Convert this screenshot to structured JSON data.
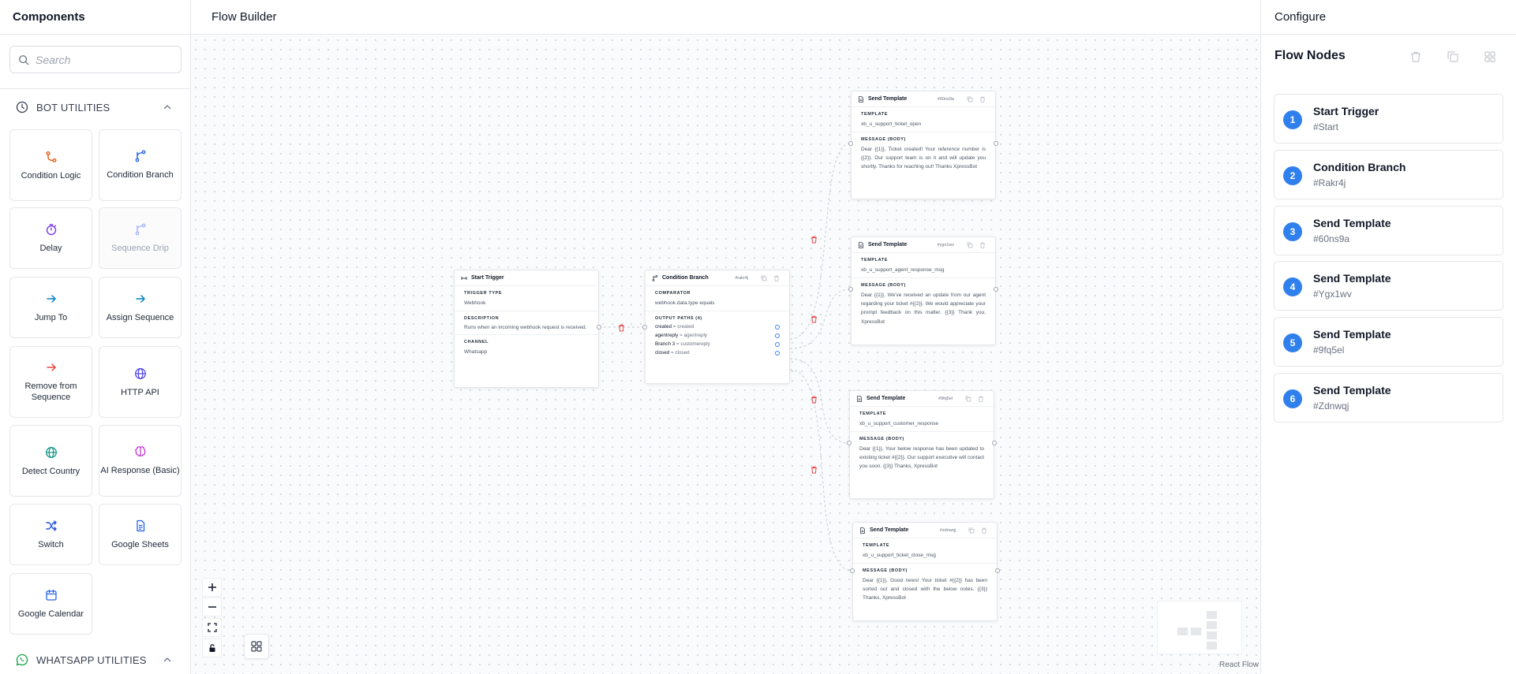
{
  "left": {
    "title": "Components",
    "search_placeholder": "Search",
    "sections": {
      "bot_utilities": "BOT UTILITIES",
      "whatsapp_utilities": "WHATSAPP UTILITIES"
    },
    "components": [
      {
        "label": "Condition Logic",
        "icon": "condition-logic-icon",
        "color": "#e8590c"
      },
      {
        "label": "Condition Branch",
        "icon": "branch-icon",
        "color": "#2563eb"
      },
      {
        "label": "Delay",
        "icon": "timer-icon",
        "color": "#7c3aed"
      },
      {
        "label": "Sequence Drip",
        "icon": "branch-icon",
        "color": "#a5b4fc"
      },
      {
        "label": "Jump To",
        "icon": "arrow-right-icon",
        "color": "#0284c7"
      },
      {
        "label": "Assign Sequence",
        "icon": "arrow-right-icon",
        "color": "#0284c7"
      },
      {
        "label": "Remove from Sequence",
        "icon": "arrow-right-icon",
        "color": "#ef4444"
      },
      {
        "label": "HTTP API",
        "icon": "globe-icon",
        "color": "#4f46e5"
      },
      {
        "label": "Detect Country",
        "icon": "globe-icon",
        "color": "#0d9488"
      },
      {
        "label": "AI Response (Basic)",
        "icon": "brain-icon",
        "color": "#c026d3"
      },
      {
        "label": "Switch",
        "icon": "shuffle-icon",
        "color": "#1d4ed8"
      },
      {
        "label": "Google Sheets",
        "icon": "sheet-icon",
        "color": "#2563eb"
      },
      {
        "label": "Google Calendar",
        "icon": "calendar-icon",
        "color": "#2563eb"
      }
    ]
  },
  "center": {
    "title": "Flow Builder",
    "attribution": "React Flow",
    "nodes": {
      "start": {
        "title": "Start Trigger",
        "trigger_type_label": "TRIGGER TYPE",
        "trigger_type": "Webhook",
        "description_label": "DESCRIPTION",
        "description": "Runs when an incoming webhook request is received.",
        "channel_label": "CHANNEL",
        "channel": "Whatsapp"
      },
      "branch": {
        "title": "Condition Branch",
        "id": "#rakr4j",
        "comparator_label": "COMPARATOR",
        "comparator": "webhook.data.type equals",
        "paths_label": "OUTPUT PATHS (4)",
        "paths": [
          {
            "name": "created",
            "value": "= created"
          },
          {
            "name": "agentreply",
            "value": "= agentreply"
          },
          {
            "name": "Branch 3",
            "value": "= customereply"
          },
          {
            "name": "closed",
            "value": "= closed"
          }
        ]
      },
      "templates": [
        {
          "title": "Send Template",
          "id": "#60ns9a",
          "template_label": "TEMPLATE",
          "template": "xb_u_support_ticket_open",
          "message_label": "MESSAGE (BODY)",
          "message": "Dear {{1}}, Ticket created! Your reference number is {{2}}. Our support team is on it and will update you shortly. Thanks for reaching out! Thanks XpressBot"
        },
        {
          "title": "Send Template",
          "id": "#ygx1wv",
          "template_label": "TEMPLATE",
          "template": "xb_u_support_agent_response_msg",
          "message_label": "MESSAGE (BODY)",
          "message": "Dear {{1}}, We've received an update from our agent regarding your ticket #{{2}}. We would appreciate your prompt feedback on this matter. {{3}} Thank you, XpressBot"
        },
        {
          "title": "Send Template",
          "id": "#9fq5el",
          "template_label": "TEMPLATE",
          "template": "xb_u_support_customer_response",
          "message_label": "MESSAGE (BODY)",
          "message": "Dear {{1}}, Your below response has been updated to existing ticket #{{2}}. Our support executive will contact you soon. {{3}} Thanks, XpressBot"
        },
        {
          "title": "Send Template",
          "id": "#zdnwqj",
          "template_label": "TEMPLATE",
          "template": "xb_u_support_ticket_close_msg",
          "message_label": "MESSAGE (BODY)",
          "message": "Dear {{1}}, Good news! Your ticket #{{2}} has been sorted out and closed with the below notes. {{3}} Thanks, XpressBot"
        }
      ]
    }
  },
  "right": {
    "title": "Configure",
    "section_title": "Flow Nodes",
    "items": [
      {
        "num": "1",
        "name": "Start Trigger",
        "id": "#Start"
      },
      {
        "num": "2",
        "name": "Condition Branch",
        "id": "#Rakr4j"
      },
      {
        "num": "3",
        "name": "Send Template",
        "id": "#60ns9a"
      },
      {
        "num": "4",
        "name": "Send Template",
        "id": "#Ygx1wv"
      },
      {
        "num": "5",
        "name": "Send Template",
        "id": "#9fq5el"
      },
      {
        "num": "6",
        "name": "Send Template",
        "id": "#Zdnwqj"
      }
    ]
  }
}
